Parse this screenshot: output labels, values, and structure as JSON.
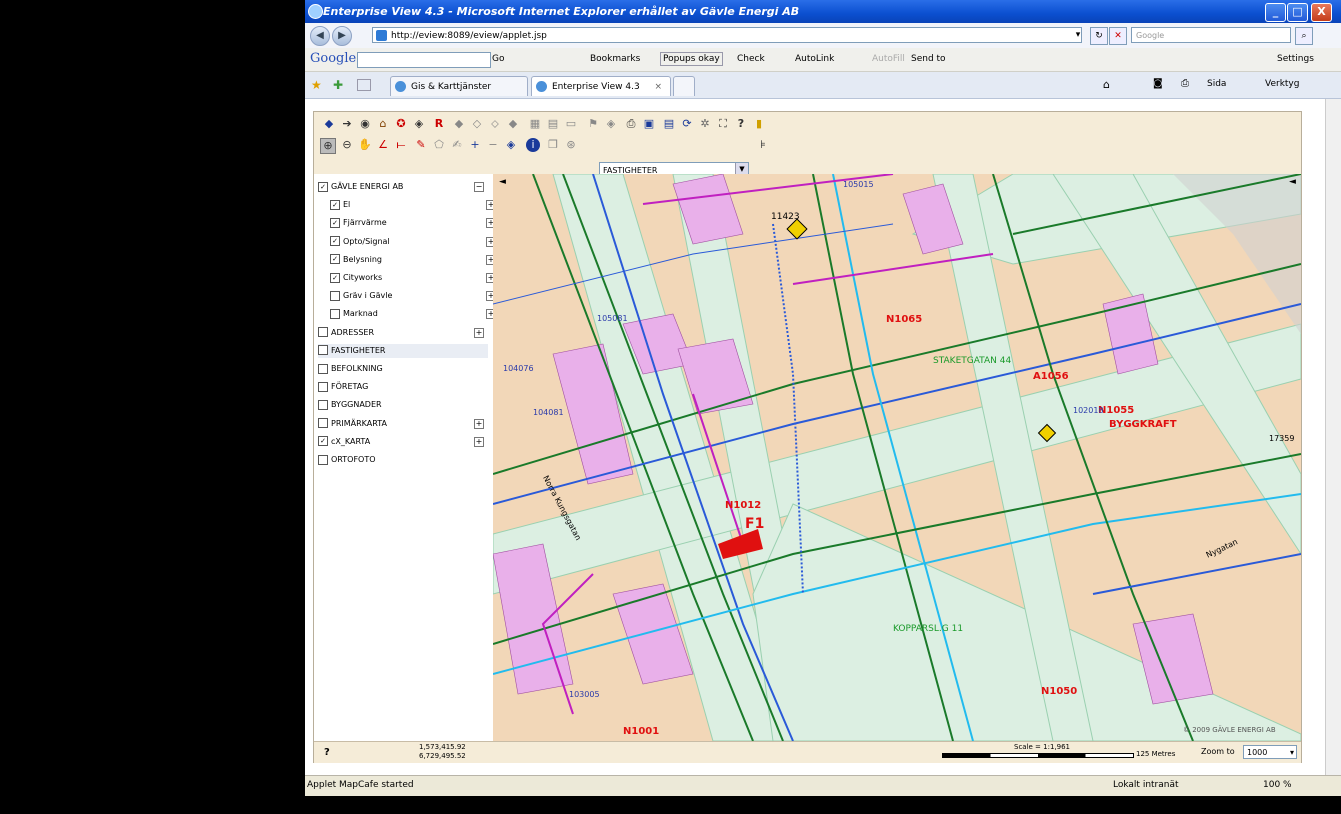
{
  "window": {
    "title": "Enterprise View 4.3 - Microsoft Internet Explorer erhållet av Gävle Energi AB",
    "minimize": "_",
    "maximize": "□",
    "close": "X"
  },
  "address": {
    "url": "http://eview:8089/eview/applet.jsp",
    "search_placeholder": "Google"
  },
  "google_bar": {
    "logo": "Google",
    "go": "Go",
    "bookmarks": "Bookmarks",
    "popups": "Popups okay",
    "check": "Check",
    "autolink": "AutoLink",
    "autofill": "AutoFill",
    "send_to": "Send to",
    "settings": "Settings"
  },
  "tabs": [
    {
      "label": "Gis & Karttjänster"
    },
    {
      "label": "Enterprise View 4.3"
    }
  ],
  "ie_toolbar": {
    "page": "Sida",
    "tools": "Verktyg"
  },
  "applet": {
    "layer_select": "FASTIGHETER",
    "layers": [
      {
        "label": "GÄVLE ENERGI AB",
        "checked": true,
        "indent": 0,
        "toggle": "−"
      },
      {
        "label": "El",
        "checked": true,
        "indent": 1,
        "toggle": "+"
      },
      {
        "label": "Fjärrvärme",
        "checked": true,
        "indent": 1,
        "toggle": "+"
      },
      {
        "label": "Opto/Signal",
        "checked": true,
        "indent": 1,
        "toggle": "+"
      },
      {
        "label": "Belysning",
        "checked": true,
        "indent": 1,
        "toggle": "+"
      },
      {
        "label": "Cityworks",
        "checked": true,
        "indent": 1,
        "toggle": "+"
      },
      {
        "label": "Gräv i Gävle",
        "checked": false,
        "indent": 1,
        "toggle": "+"
      },
      {
        "label": "Marknad",
        "checked": false,
        "indent": 1,
        "toggle": "+"
      },
      {
        "label": "ADRESSER",
        "checked": false,
        "indent": 0,
        "toggle": "+"
      },
      {
        "label": "FASTIGHETER",
        "checked": false,
        "indent": 0,
        "toggle": ""
      },
      {
        "label": "BEFOLKNING",
        "checked": false,
        "indent": 0,
        "toggle": ""
      },
      {
        "label": "FÖRETAG",
        "checked": false,
        "indent": 0,
        "toggle": ""
      },
      {
        "label": "BYGGNADER",
        "checked": false,
        "indent": 0,
        "toggle": ""
      },
      {
        "label": "PRIMÄRKARTA",
        "checked": false,
        "indent": 0,
        "toggle": "+"
      },
      {
        "label": "cX_KARTA",
        "checked": true,
        "indent": 0,
        "toggle": "+"
      },
      {
        "label": "ORTOFOTO",
        "checked": false,
        "indent": 0,
        "toggle": ""
      }
    ],
    "help": "?",
    "coord_x": "1,573,415.92",
    "coord_y": "6,729,495.52",
    "scale_label": "Scale = 1:1,961",
    "scale_units": "125 Metres",
    "zoom_label": "Zoom to",
    "zoom_value": "1000",
    "copyright": "© 2009 GÄVLE ENERGI AB"
  },
  "map_labels": {
    "n1065": "N1065",
    "n1012": "N1012",
    "n1055": "N1055",
    "byggkraft": "BYGGKRAFT",
    "n1050": "N1050",
    "n1001": "N1001",
    "a1056": "A1056",
    "f1": "F1",
    "staketgatan": "STAKETGATAN 44",
    "kopparsl": "KOPPARSL.G 11",
    "num_11423": "11423",
    "num_105015": "105015",
    "num_17359": "17359",
    "num_102018": "102018",
    "num_104076": "104076",
    "num_104081": "104081",
    "num_105081": "105081",
    "num_103005": "103005",
    "kungsgatan": "Norra Kungsgatan",
    "nygatan": "Nygatan"
  },
  "status": {
    "left": "Applet MapCafe started",
    "zone": "Lokalt intranät",
    "zoom": "100 %"
  },
  "colors": {
    "title_blue": "#0b4fd0",
    "map_bg": "#f2d7b8",
    "street": "#dff0e4",
    "building": "#e8b0e8",
    "green_line": "#1a7a2a",
    "blue_line": "#2a5ad8",
    "magenta_line": "#c020c0",
    "red_label": "#e01010"
  }
}
